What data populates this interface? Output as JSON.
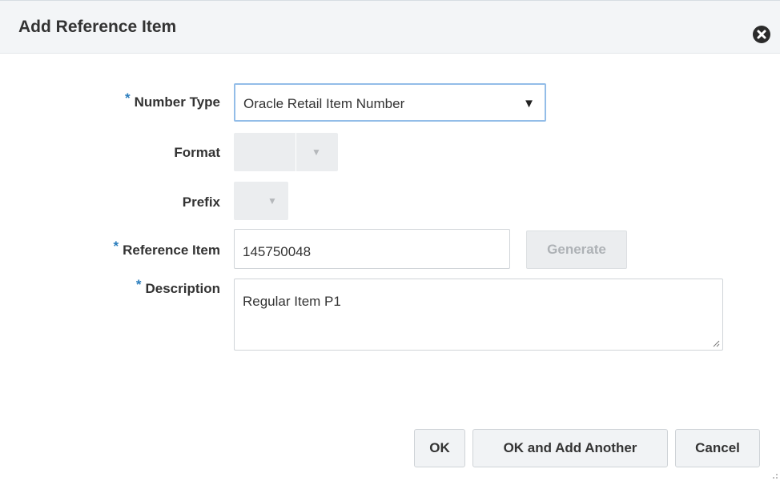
{
  "dialog": {
    "title": "Add Reference Item"
  },
  "form": {
    "required_marker": "*",
    "number_type": {
      "label": "Number Type",
      "value": "Oracle Retail Item Number"
    },
    "format": {
      "label": "Format"
    },
    "prefix": {
      "label": "Prefix"
    },
    "reference_item": {
      "label": "Reference Item",
      "value": "145750048",
      "generate_label": "Generate"
    },
    "description": {
      "label": "Description",
      "value": "Regular Item P1"
    }
  },
  "footer": {
    "ok_label": "OK",
    "ok_add_label": "OK and Add Another",
    "cancel_label": "Cancel"
  }
}
